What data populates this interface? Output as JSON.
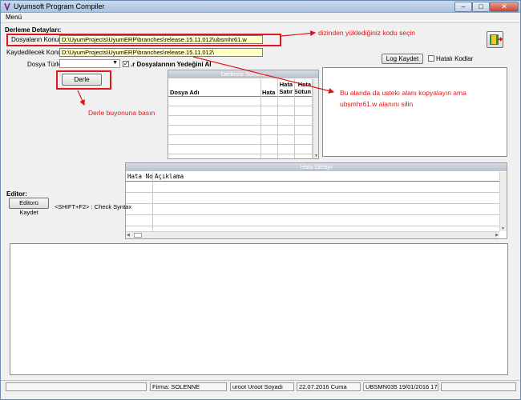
{
  "window": {
    "title": "Uyumsoft Program Compiler"
  },
  "menu": {
    "items": [
      "Menü"
    ]
  },
  "compile_details": {
    "section_title": "Derleme Detayları:",
    "source_label": "Dosyaların Konumu:",
    "source_value": "D:\\UyumProjects\\UyumERP\\branches\\release.15.11.012\\ubsmhr61.w",
    "target_label": "Kaydedilecek Konum:",
    "target_value": "D:\\UyumProjects\\UyumERP\\branches\\release.15.11.012\\",
    "file_types_label": "Dosya Türleri:",
    "file_types_value": "",
    "backup_checkbox_label": ".r Dosyalarının Yedeğini Al",
    "compile_button": "Derle",
    "log_save_button": "Log Kaydet",
    "errors_checkbox_label": "Hatalı Kodlar"
  },
  "compile_result": {
    "title": "Derleme Sonucu",
    "columns": [
      "Dosya Adı",
      "Hata",
      "Hata Satır",
      "Hata Sütun"
    ]
  },
  "error_detail": {
    "title": "Hata Detayı",
    "columns": [
      "Hata No",
      "Açıklama"
    ]
  },
  "editor": {
    "label": "Editor:",
    "save_button": "Editorü Kaydet",
    "shortcut_text": "<SHIFT+F2> : Check Syntax"
  },
  "annotations": {
    "source_hint": "dizinden yüklediğiniz kodu seçin",
    "target_hint_1": "Bu alanda da ustekı alanı kopyalayın ama",
    "target_hint_2": "ubsmhr61.w alanını silin",
    "compile_hint": "Derle buyonuna basın"
  },
  "status_bar": {
    "company": "Firma: SOLENNE",
    "user": "uroot Uroot Soyadı",
    "date": "22.07.2016  Cuma",
    "version": "UBSMN035 19/01/2016 17:17"
  }
}
